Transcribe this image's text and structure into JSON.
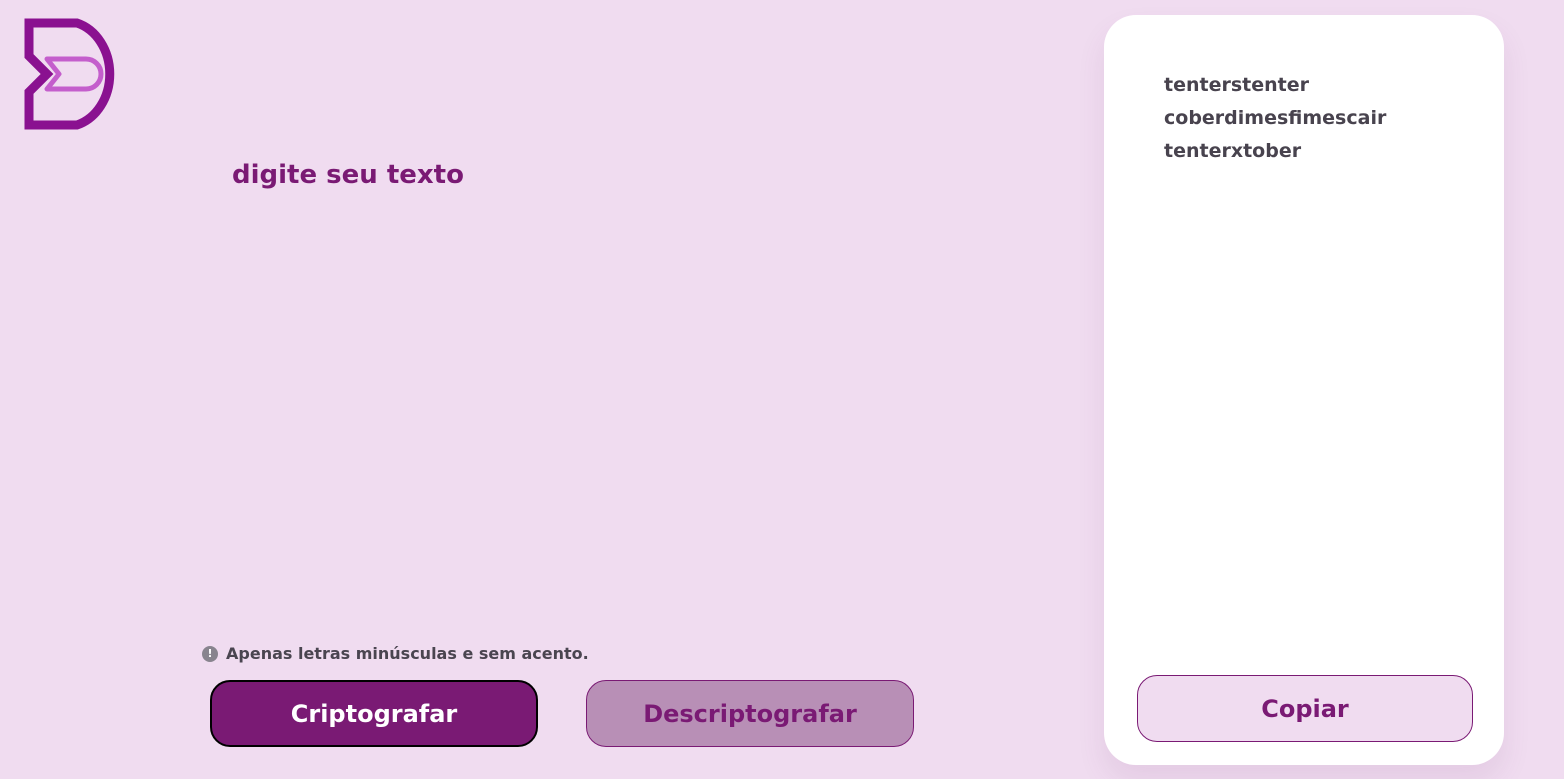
{
  "logo": {
    "icon": "d-logo-icon",
    "colors": [
      "#8a1190",
      "#c45ecc"
    ]
  },
  "input": {
    "placeholder": "digite seu texto",
    "value": ""
  },
  "hint": {
    "icon": "info-icon",
    "icon_glyph": "!",
    "text": "Apenas letras minúsculas e sem acento."
  },
  "buttons": {
    "encrypt_label": "Criptografar",
    "decrypt_label": "Descriptografar"
  },
  "output": {
    "text": "tenterstenter coberdimesfimescair tenterxtober",
    "copy_label": "Copiar"
  },
  "colors": {
    "background": "#f0dcf0",
    "accent": "#7a1a74",
    "secondary_button": "#b88fb6",
    "card": "#ffffff"
  }
}
